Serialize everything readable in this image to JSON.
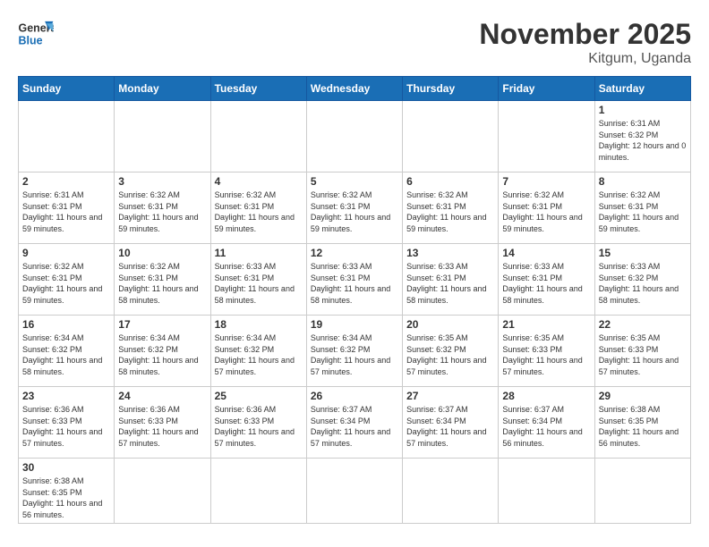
{
  "header": {
    "logo_general": "General",
    "logo_blue": "Blue",
    "month_title": "November 2025",
    "location": "Kitgum, Uganda"
  },
  "days_of_week": [
    "Sunday",
    "Monday",
    "Tuesday",
    "Wednesday",
    "Thursday",
    "Friday",
    "Saturday"
  ],
  "weeks": [
    [
      {
        "day": "",
        "info": ""
      },
      {
        "day": "",
        "info": ""
      },
      {
        "day": "",
        "info": ""
      },
      {
        "day": "",
        "info": ""
      },
      {
        "day": "",
        "info": ""
      },
      {
        "day": "",
        "info": ""
      },
      {
        "day": "1",
        "info": "Sunrise: 6:31 AM\nSunset: 6:32 PM\nDaylight: 12 hours and 0 minutes."
      }
    ],
    [
      {
        "day": "2",
        "info": "Sunrise: 6:31 AM\nSunset: 6:31 PM\nDaylight: 11 hours and 59 minutes."
      },
      {
        "day": "3",
        "info": "Sunrise: 6:32 AM\nSunset: 6:31 PM\nDaylight: 11 hours and 59 minutes."
      },
      {
        "day": "4",
        "info": "Sunrise: 6:32 AM\nSunset: 6:31 PM\nDaylight: 11 hours and 59 minutes."
      },
      {
        "day": "5",
        "info": "Sunrise: 6:32 AM\nSunset: 6:31 PM\nDaylight: 11 hours and 59 minutes."
      },
      {
        "day": "6",
        "info": "Sunrise: 6:32 AM\nSunset: 6:31 PM\nDaylight: 11 hours and 59 minutes."
      },
      {
        "day": "7",
        "info": "Sunrise: 6:32 AM\nSunset: 6:31 PM\nDaylight: 11 hours and 59 minutes."
      },
      {
        "day": "8",
        "info": "Sunrise: 6:32 AM\nSunset: 6:31 PM\nDaylight: 11 hours and 59 minutes."
      }
    ],
    [
      {
        "day": "9",
        "info": "Sunrise: 6:32 AM\nSunset: 6:31 PM\nDaylight: 11 hours and 59 minutes."
      },
      {
        "day": "10",
        "info": "Sunrise: 6:32 AM\nSunset: 6:31 PM\nDaylight: 11 hours and 58 minutes."
      },
      {
        "day": "11",
        "info": "Sunrise: 6:33 AM\nSunset: 6:31 PM\nDaylight: 11 hours and 58 minutes."
      },
      {
        "day": "12",
        "info": "Sunrise: 6:33 AM\nSunset: 6:31 PM\nDaylight: 11 hours and 58 minutes."
      },
      {
        "day": "13",
        "info": "Sunrise: 6:33 AM\nSunset: 6:31 PM\nDaylight: 11 hours and 58 minutes."
      },
      {
        "day": "14",
        "info": "Sunrise: 6:33 AM\nSunset: 6:31 PM\nDaylight: 11 hours and 58 minutes."
      },
      {
        "day": "15",
        "info": "Sunrise: 6:33 AM\nSunset: 6:32 PM\nDaylight: 11 hours and 58 minutes."
      }
    ],
    [
      {
        "day": "16",
        "info": "Sunrise: 6:34 AM\nSunset: 6:32 PM\nDaylight: 11 hours and 58 minutes."
      },
      {
        "day": "17",
        "info": "Sunrise: 6:34 AM\nSunset: 6:32 PM\nDaylight: 11 hours and 58 minutes."
      },
      {
        "day": "18",
        "info": "Sunrise: 6:34 AM\nSunset: 6:32 PM\nDaylight: 11 hours and 57 minutes."
      },
      {
        "day": "19",
        "info": "Sunrise: 6:34 AM\nSunset: 6:32 PM\nDaylight: 11 hours and 57 minutes."
      },
      {
        "day": "20",
        "info": "Sunrise: 6:35 AM\nSunset: 6:32 PM\nDaylight: 11 hours and 57 minutes."
      },
      {
        "day": "21",
        "info": "Sunrise: 6:35 AM\nSunset: 6:33 PM\nDaylight: 11 hours and 57 minutes."
      },
      {
        "day": "22",
        "info": "Sunrise: 6:35 AM\nSunset: 6:33 PM\nDaylight: 11 hours and 57 minutes."
      }
    ],
    [
      {
        "day": "23",
        "info": "Sunrise: 6:36 AM\nSunset: 6:33 PM\nDaylight: 11 hours and 57 minutes."
      },
      {
        "day": "24",
        "info": "Sunrise: 6:36 AM\nSunset: 6:33 PM\nDaylight: 11 hours and 57 minutes."
      },
      {
        "day": "25",
        "info": "Sunrise: 6:36 AM\nSunset: 6:33 PM\nDaylight: 11 hours and 57 minutes."
      },
      {
        "day": "26",
        "info": "Sunrise: 6:37 AM\nSunset: 6:34 PM\nDaylight: 11 hours and 57 minutes."
      },
      {
        "day": "27",
        "info": "Sunrise: 6:37 AM\nSunset: 6:34 PM\nDaylight: 11 hours and 57 minutes."
      },
      {
        "day": "28",
        "info": "Sunrise: 6:37 AM\nSunset: 6:34 PM\nDaylight: 11 hours and 56 minutes."
      },
      {
        "day": "29",
        "info": "Sunrise: 6:38 AM\nSunset: 6:35 PM\nDaylight: 11 hours and 56 minutes."
      }
    ],
    [
      {
        "day": "30",
        "info": "Sunrise: 6:38 AM\nSunset: 6:35 PM\nDaylight: 11 hours and 56 minutes."
      },
      {
        "day": "",
        "info": ""
      },
      {
        "day": "",
        "info": ""
      },
      {
        "day": "",
        "info": ""
      },
      {
        "day": "",
        "info": ""
      },
      {
        "day": "",
        "info": ""
      },
      {
        "day": "",
        "info": ""
      }
    ]
  ]
}
